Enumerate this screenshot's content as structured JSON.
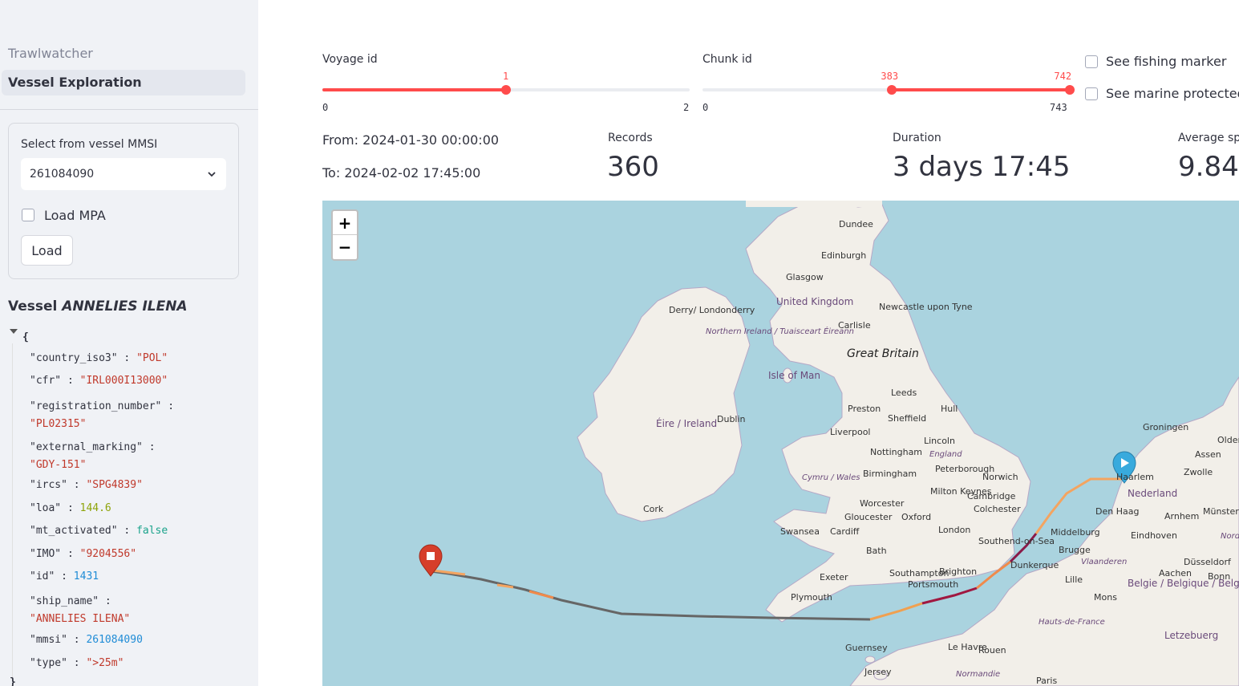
{
  "sidebar": {
    "nav": {
      "app": "Trawlwatcher",
      "page": "Vessel Exploration"
    },
    "form": {
      "select_label": "Select from vessel MMSI",
      "select_value": "261084090",
      "load_mpa_label": "Load MPA",
      "load_button": "Load"
    },
    "vessel": {
      "prefix": "Vessel",
      "name": "ANNELIES ILENA"
    },
    "json_rows": [
      {
        "key": "\"country_iso3\"",
        "value": "\"POL\""
      },
      {
        "key": "\"cfr\"",
        "value": "\"IRL000I13000\""
      },
      {
        "key": "\"registration_number\"",
        "value": "\"PL02315\""
      },
      {
        "key": "\"external_marking\"",
        "value": "\"GDY-151\""
      },
      {
        "key": "\"ircs\"",
        "value": "\"SPG4839\""
      },
      {
        "key": "\"loa\"",
        "value": "144.6"
      },
      {
        "key": "\"mt_activated\"",
        "value": "false"
      },
      {
        "key": "\"IMO\"",
        "value": "\"9204556\""
      },
      {
        "key": "\"id\"",
        "value": "1431"
      },
      {
        "key": "\"ship_name\"",
        "value": "\"ANNELIES ILENA\""
      },
      {
        "key": "\"mmsi\"",
        "value": "261084090"
      },
      {
        "key": "\"type\"",
        "value": "\">25m\""
      }
    ],
    "json_open": "{",
    "json_close": "}"
  },
  "controls": {
    "voyage": {
      "label": "Voyage id",
      "min": "0",
      "max": "2",
      "value": "1",
      "value_fraction": 0.5
    },
    "chunk": {
      "label": "Chunk id",
      "min": "0",
      "max": "743",
      "low": "383",
      "high": "742",
      "low_fraction": 0.515,
      "high_fraction": 0.9987
    },
    "checks": [
      "See fishing marker",
      "See marine protected areas"
    ]
  },
  "summary": {
    "from": "From: 2024-01-30 00:00:00",
    "to": "To: 2024-02-02 17:45:00",
    "records_label": "Records",
    "records_value": "360",
    "duration_label": "Duration",
    "duration_value": "3 days 17:45",
    "speed_label": "Average speed",
    "speed_value": "9.84"
  },
  "map": {
    "zoom_in": "+",
    "zoom_out": "−",
    "start_marker_icon": "play-icon",
    "end_marker_icon": "stop-icon",
    "labels": [
      "Dundee",
      "Edinburgh",
      "Glasgow",
      "United Kingdom",
      "Newcastle upon Tyne",
      "Carlisle",
      "Derry/ Londonderry",
      "Northern Ireland / Tuaisceart Éireann",
      "Great Britain",
      "Isle of Man",
      "Éire / Ireland",
      "Dublin",
      "Leeds",
      "Preston",
      "Hull",
      "Sheffield",
      "Liverpool",
      "Lincoln",
      "Nottingham",
      "England",
      "Peterborough",
      "Birmingham",
      "Norwich",
      "Cymru / Wales",
      "Milton Keynes",
      "Cambridge",
      "Colchester",
      "Worcester",
      "Gloucester",
      "Oxford",
      "Cork",
      "Swansea",
      "Cardiff",
      "London",
      "Southend-on-Sea",
      "Bath",
      "Exeter",
      "Southampton",
      "Brighton",
      "Portsmouth",
      "Plymouth",
      "Dunkerque",
      "Guernsey",
      "Jersey",
      "Le Havre",
      "Rouen",
      "Normandie",
      "Paris",
      "Hauts-de-France",
      "Groningen",
      "Olden",
      "Assen",
      "Zwolle",
      "Nederland",
      "Haarlem",
      "Den Haag",
      "Arnhem",
      "Münster",
      "Middelburg",
      "Eindhoven",
      "Brugge",
      "Vlaanderen",
      "Nord-West",
      "Düsseldorf",
      "Lille",
      "Aachen",
      "Bonn",
      "Mons",
      "Belgie / Belgique / Belgien",
      "Letzebuerg"
    ]
  },
  "colors": {
    "accent": "#ff4b4b",
    "sea": "#aad3df",
    "land": "#f2efe9",
    "track_gray": "#666666",
    "marker_end": "#d63e2a",
    "marker_start": "#38aadd"
  }
}
